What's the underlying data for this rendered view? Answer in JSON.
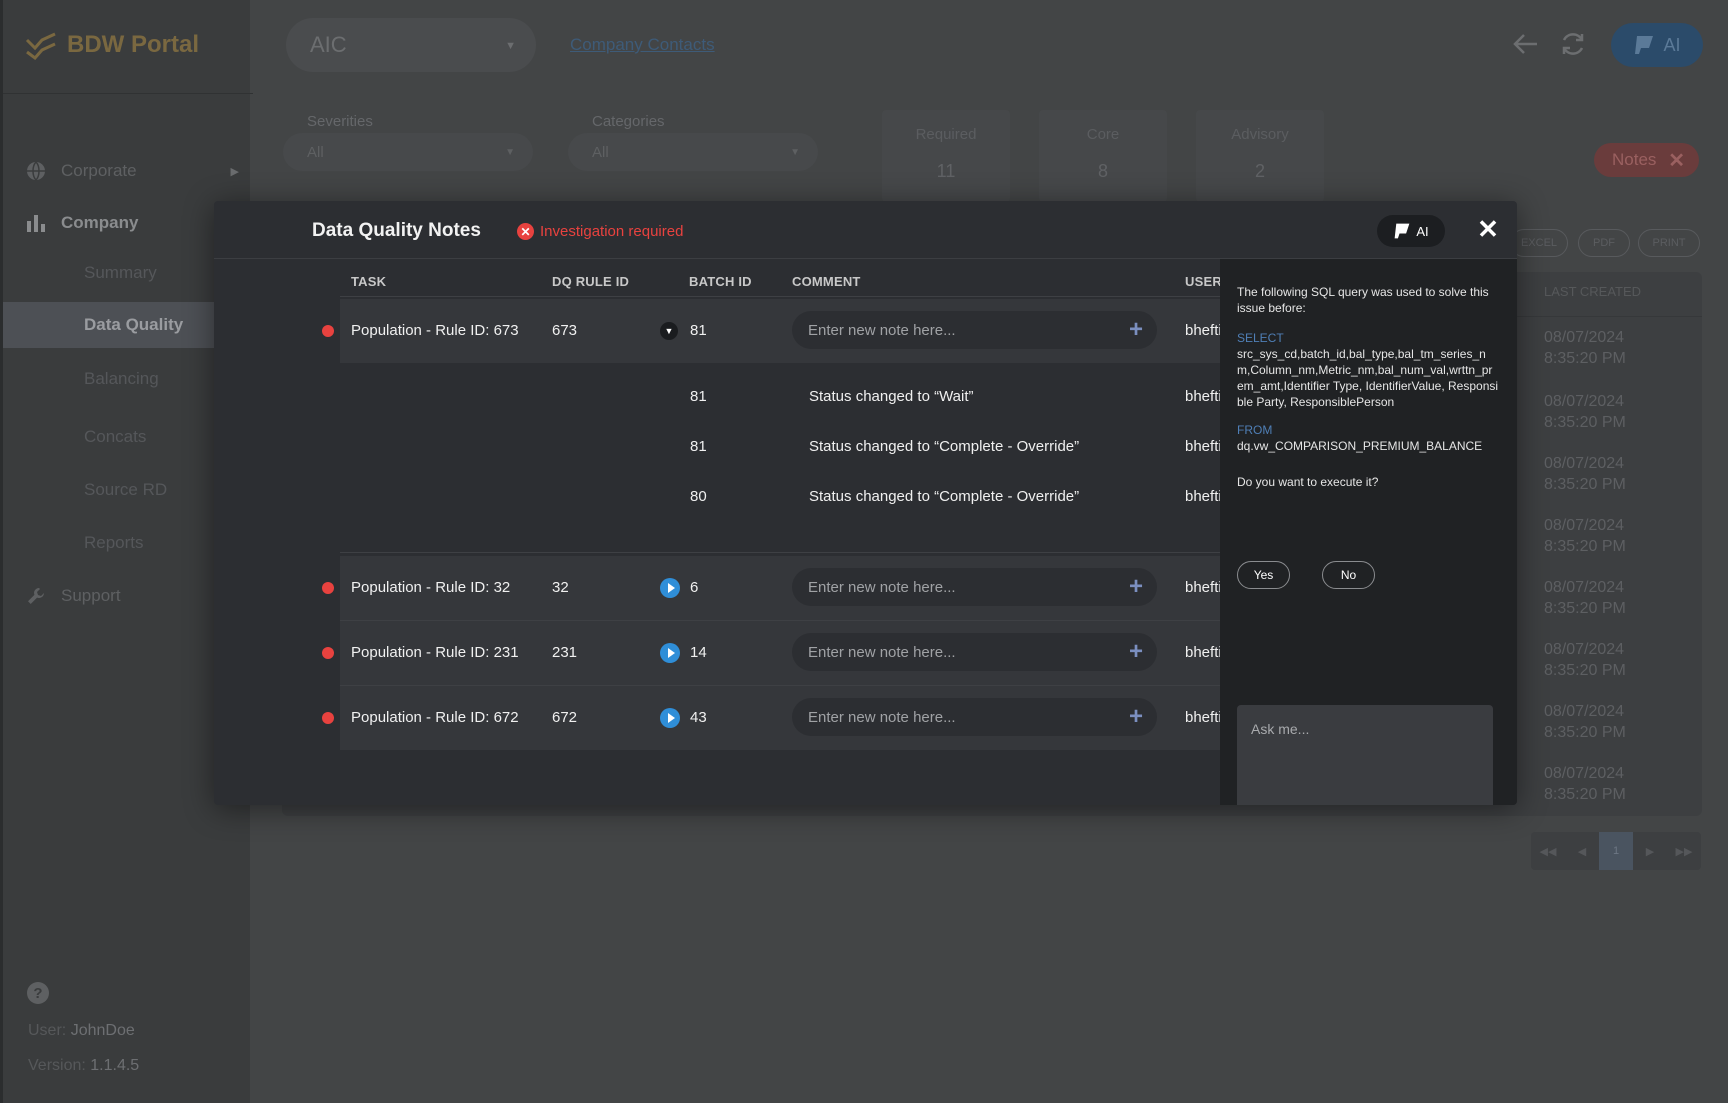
{
  "app": {
    "title": "BDW Portal",
    "version_label": "Version:",
    "version": "1.1.4.5",
    "user_label": "User:",
    "user": "JohnDoe"
  },
  "colors": {
    "accent_blue": "#2f8ed8",
    "error_red": "#e8423f",
    "logo_gold": "#7a6840"
  },
  "sidebar": {
    "items": [
      {
        "label": "Corporate",
        "icon": "globe-icon"
      },
      {
        "label": "Company",
        "icon": "bar-chart-icon"
      },
      {
        "label": "Support",
        "icon": "wrench-icon"
      }
    ],
    "company_sub": [
      "Summary",
      "Data Quality",
      "Balancing",
      "Concats",
      "Source RD",
      "Reports"
    ]
  },
  "topbar": {
    "company": "AIC",
    "link": "Company Contacts",
    "ai_label": "AI"
  },
  "filters": {
    "severities_label": "Severities",
    "severities_value": "All",
    "categories_label": "Categories",
    "categories_value": "All"
  },
  "stats": [
    {
      "label": "Required",
      "value": "11"
    },
    {
      "label": "Core",
      "value": "8"
    },
    {
      "label": "Advisory",
      "value": "2"
    }
  ],
  "notes_chip": "Notes",
  "export": {
    "excel": "EXCEL",
    "pdf": "PDF",
    "print": "PRINT"
  },
  "bg_table": {
    "last_created_header": "LAST CREATED",
    "rows": [
      {
        "date": "08/07/2024",
        "time": "8:35:20 PM"
      },
      {
        "date": "08/07/2024",
        "time": "8:35:20 PM"
      },
      {
        "date": "08/07/2024",
        "time": "8:35:20 PM"
      },
      {
        "date": "08/07/2024",
        "time": "8:35:20 PM"
      },
      {
        "date": "08/07/2024",
        "time": "8:35:20 PM"
      },
      {
        "date": "08/07/2024",
        "time": "8:35:20 PM"
      },
      {
        "date": "08/07/2024",
        "time": "8:35:20 PM"
      },
      {
        "date": "08/07/2024",
        "time": "8:35:20 PM"
      }
    ],
    "page": "1"
  },
  "modal": {
    "title": "Data Quality Notes",
    "status": "Investigation required",
    "ai_label": "AI",
    "columns": {
      "task": "TASK",
      "rule": "DQ RULE ID",
      "batch": "BATCH ID",
      "comment": "COMMENT",
      "user": "USER"
    },
    "note_placeholder": "Enter new note here...",
    "rows": [
      {
        "task": "Population - Rule ID: 673",
        "rule": "673",
        "batch": "81",
        "user": "bhefti"
      },
      {
        "task": "Population - Rule ID: 32",
        "rule": "32",
        "batch": "6",
        "user": "bhefti"
      },
      {
        "task": "Population - Rule ID: 231",
        "rule": "231",
        "batch": "14",
        "user": "bhefti"
      },
      {
        "task": "Population - Rule ID: 672",
        "rule": "672",
        "batch": "43",
        "user": "bhefti"
      }
    ],
    "history": [
      {
        "batch": "81",
        "comment": "Status changed to “Wait”",
        "user": "bhefti"
      },
      {
        "batch": "81",
        "comment": "Status changed to “Complete - Override”",
        "user": "bhefti"
      },
      {
        "batch": "80",
        "comment": "Status changed to “Complete - Override”",
        "user": "bhefti"
      }
    ]
  },
  "ai_panel": {
    "intro": "The following SQL query was used to solve this issue before:",
    "kw_select": "SELECT",
    "select_fields": "src_sys_cd,batch_id,bal_type,bal_tm_series_nm,Column_nm,Metric_nm,bal_num_val,wrttn_prem_amt,Identifier Type, IdentifierValue, Responsible Party, ResponsiblePerson",
    "kw_from": "FROM",
    "from_table": "dq.vw_COMPARISON_PREMIUM_BALANCE",
    "question": "Do you want to execute it?",
    "yes": "Yes",
    "no": "No",
    "ask_placeholder": "Ask me..."
  }
}
